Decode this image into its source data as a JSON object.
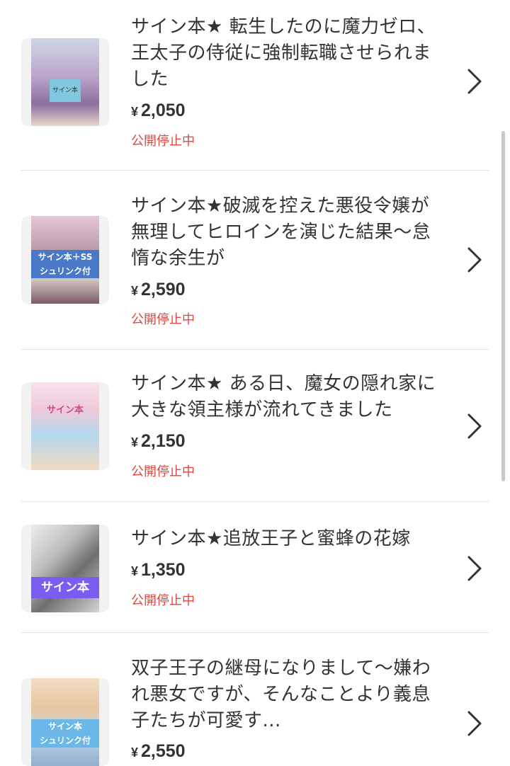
{
  "items": [
    {
      "title": "サイン本★ 転生したのに魔力ゼロ、王太子の侍従に強制転職させられました",
      "price_currency": "¥",
      "price_value": "2,050",
      "status": "公開停止中",
      "thumb_overlay": "",
      "thumb_colors": [
        "#cfd6e6",
        "#8b6f9e"
      ]
    },
    {
      "title": "サイン本★破滅を控えた悪役令嬢が無理してヒロインを演じた結果〜怠惰な余生が",
      "price_currency": "¥",
      "price_value": "2,590",
      "status": "公開停止中",
      "thumb_overlay": "サイン本＋SS\nシュリンク付",
      "thumb_colors": [
        "#d9b4c8",
        "#4a78c8"
      ]
    },
    {
      "title": "サイン本★ ある日、魔女の隠れ家に大きな領主様が流れてきました",
      "price_currency": "¥",
      "price_value": "2,150",
      "status": "公開停止中",
      "thumb_overlay": "",
      "thumb_colors": [
        "#f1c9da",
        "#9ad0e8"
      ]
    },
    {
      "title": "サイン本★追放王子と蜜蜂の花嫁",
      "price_currency": "¥",
      "price_value": "1,350",
      "status": "公開停止中",
      "thumb_overlay": "サイン本",
      "thumb_colors": [
        "#d8d8d8",
        "#7a5cf0"
      ]
    },
    {
      "title": "双子王子の継母になりまして〜嫌われ悪女ですが、そんなことより義息子たちが可愛す...",
      "price_currency": "¥",
      "price_value": "2,550",
      "status": "",
      "thumb_overlay": "サイン本\nシュリンク付",
      "thumb_colors": [
        "#e7c6a0",
        "#6bb8e8"
      ]
    }
  ],
  "chevron_icon": "chevron-right-icon",
  "status_color": "#e0473f"
}
